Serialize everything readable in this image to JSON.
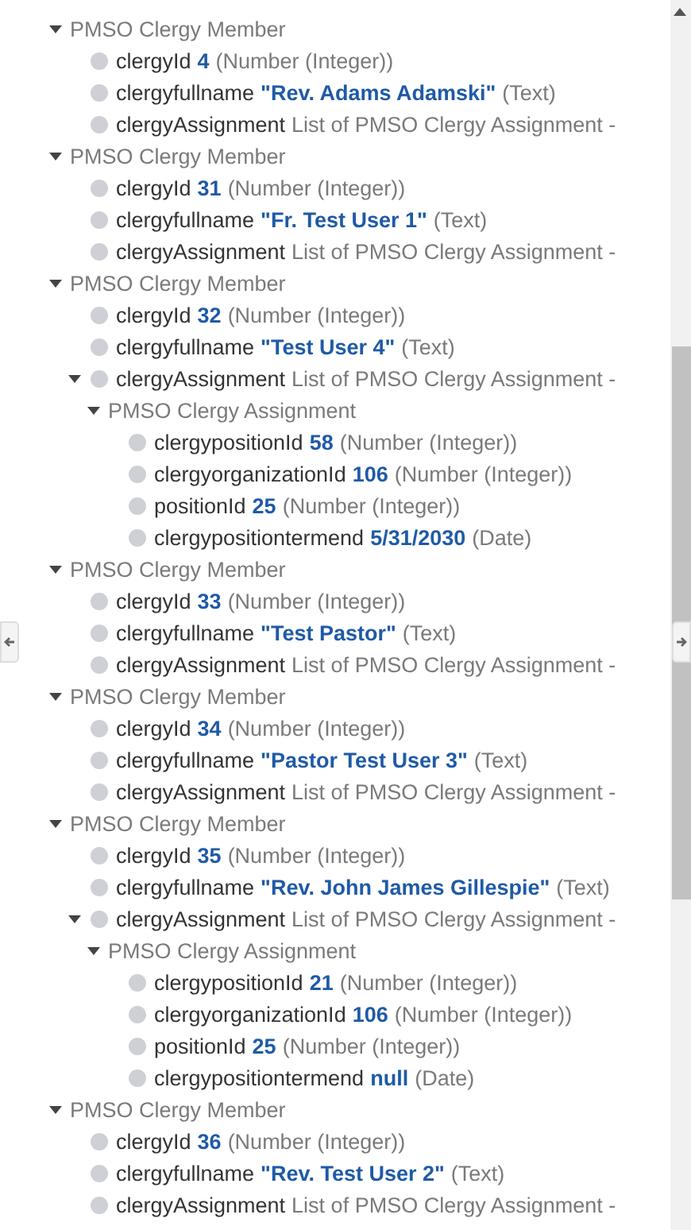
{
  "tree": [
    {
      "label": "PMSO Clergy Member",
      "expanded": true,
      "children": [
        {
          "name": "clergyId",
          "value": "4",
          "type": "(Number (Integer))"
        },
        {
          "name": "clergyfullname",
          "value": "\"Rev. Adams Adamski\"",
          "type": "(Text)"
        },
        {
          "name": "clergyAssignment",
          "type": "List of PMSO Clergy Assignment -"
        }
      ]
    },
    {
      "label": "PMSO Clergy Member",
      "expanded": true,
      "children": [
        {
          "name": "clergyId",
          "value": "31",
          "type": "(Number (Integer))"
        },
        {
          "name": "clergyfullname",
          "value": "\"Fr. Test User 1\"",
          "type": "(Text)"
        },
        {
          "name": "clergyAssignment",
          "type": "List of PMSO Clergy Assignment -"
        }
      ]
    },
    {
      "label": "PMSO Clergy Member",
      "expanded": true,
      "children": [
        {
          "name": "clergyId",
          "value": "32",
          "type": "(Number (Integer))"
        },
        {
          "name": "clergyfullname",
          "value": "\"Test User 4\"",
          "type": "(Text)"
        },
        {
          "name": "clergyAssignment",
          "type": "List of PMSO Clergy Assignment -",
          "expanded": true,
          "children": [
            {
              "label": "PMSO Clergy Assignment",
              "expanded": true,
              "children": [
                {
                  "name": "clergypositionId",
                  "value": "58",
                  "type": "(Number (Integer))"
                },
                {
                  "name": "clergyorganizationId",
                  "value": "106",
                  "type": "(Number (Integer))"
                },
                {
                  "name": "positionId",
                  "value": "25",
                  "type": "(Number (Integer))"
                },
                {
                  "name": "clergypositiontermend",
                  "value": "5/31/2030",
                  "type": "(Date)"
                }
              ]
            }
          ]
        }
      ]
    },
    {
      "label": "PMSO Clergy Member",
      "expanded": true,
      "children": [
        {
          "name": "clergyId",
          "value": "33",
          "type": "(Number (Integer))"
        },
        {
          "name": "clergyfullname",
          "value": "\"Test Pastor\"",
          "type": "(Text)"
        },
        {
          "name": "clergyAssignment",
          "type": "List of PMSO Clergy Assignment -"
        }
      ]
    },
    {
      "label": "PMSO Clergy Member",
      "expanded": true,
      "children": [
        {
          "name": "clergyId",
          "value": "34",
          "type": "(Number (Integer))"
        },
        {
          "name": "clergyfullname",
          "value": "\"Pastor Test User 3\"",
          "type": "(Text)"
        },
        {
          "name": "clergyAssignment",
          "type": "List of PMSO Clergy Assignment -"
        }
      ]
    },
    {
      "label": "PMSO Clergy Member",
      "expanded": true,
      "children": [
        {
          "name": "clergyId",
          "value": "35",
          "type": "(Number (Integer))"
        },
        {
          "name": "clergyfullname",
          "value": "\"Rev. John James Gillespie\"",
          "type": "(Text)"
        },
        {
          "name": "clergyAssignment",
          "type": "List of PMSO Clergy Assignment -",
          "expanded": true,
          "children": [
            {
              "label": "PMSO Clergy Assignment",
              "expanded": true,
              "children": [
                {
                  "name": "clergypositionId",
                  "value": "21",
                  "type": "(Number (Integer))"
                },
                {
                  "name": "clergyorganizationId",
                  "value": "106",
                  "type": "(Number (Integer))"
                },
                {
                  "name": "positionId",
                  "value": "25",
                  "type": "(Number (Integer))"
                },
                {
                  "name": "clergypositiontermend",
                  "value": "null",
                  "type": "(Date)"
                }
              ]
            }
          ]
        }
      ]
    },
    {
      "label": "PMSO Clergy Member",
      "expanded": true,
      "children": [
        {
          "name": "clergyId",
          "value": "36",
          "type": "(Number (Integer))"
        },
        {
          "name": "clergyfullname",
          "value": "\"Rev. Test User 2\"",
          "type": "(Text)"
        },
        {
          "name": "clergyAssignment",
          "type": "List of PMSO Clergy Assignment -"
        }
      ]
    }
  ]
}
